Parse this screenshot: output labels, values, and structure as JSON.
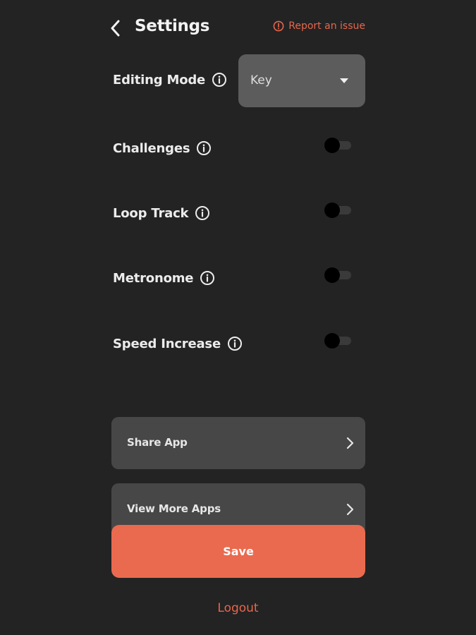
{
  "header": {
    "title": "Settings",
    "back_icon": "chevron-left-icon",
    "report_label": "Report an issue",
    "report_icon": "alert-circle-icon"
  },
  "editing_mode": {
    "label": "Editing Mode",
    "selected": "Key"
  },
  "toggles": [
    {
      "label": "Challenges",
      "on": false
    },
    {
      "label": "Loop Track",
      "on": false
    },
    {
      "label": "Metronome",
      "on": false
    },
    {
      "label": "Speed Increase",
      "on": false
    }
  ],
  "menu": [
    {
      "label": "Share App"
    },
    {
      "label": "View More Apps"
    }
  ],
  "save_label": "Save",
  "logout_label": "Logout",
  "colors": {
    "background": "#232323",
    "accent": "#ea6a4f",
    "card": "#474747",
    "dropdown": "#5c5c5c"
  }
}
